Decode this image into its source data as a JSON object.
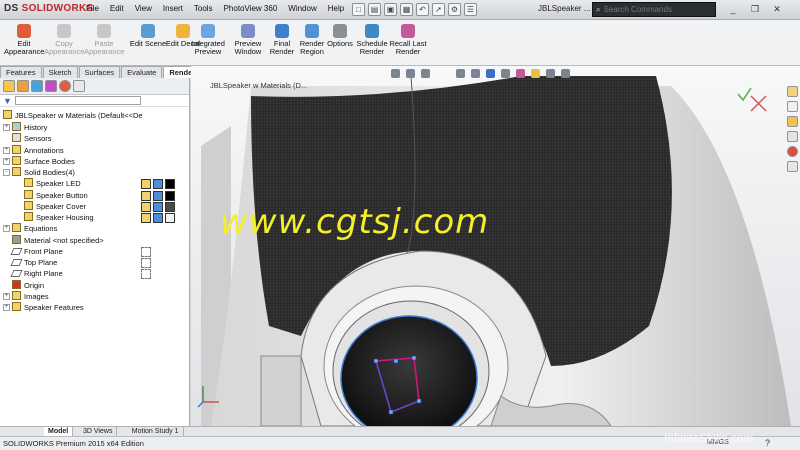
{
  "app": {
    "brand_prefix": "DS",
    "brand_name": "SOLIDWORKS"
  },
  "menu": [
    "File",
    "Edit",
    "View",
    "Insert",
    "Tools",
    "PhotoView 360",
    "Window",
    "Help"
  ],
  "doc_title": "JBLSpeaker ...",
  "search": {
    "placeholder": "Search Commands"
  },
  "ribbon": [
    {
      "label": "Edit Appearance",
      "icon": "appearance-icon",
      "enabled": true
    },
    {
      "label": "Copy Appearance",
      "icon": "copy-appearance-icon",
      "enabled": false
    },
    {
      "label": "Paste Appearance",
      "icon": "paste-appearance-icon",
      "enabled": false
    },
    {
      "label": "Edit Scene",
      "icon": "scene-icon",
      "enabled": true
    },
    {
      "label": "Edit Decal",
      "icon": "decal-icon",
      "enabled": true
    },
    {
      "label": "Integrated Preview",
      "icon": "integrated-preview-icon",
      "enabled": true
    },
    {
      "label": "Preview Window",
      "icon": "preview-window-icon",
      "enabled": true
    },
    {
      "label": "Final Render",
      "icon": "final-render-icon",
      "enabled": true
    },
    {
      "label": "Render Region",
      "icon": "render-region-icon",
      "enabled": true
    },
    {
      "label": "Options",
      "icon": "options-icon",
      "enabled": true
    },
    {
      "label": "Schedule Render",
      "icon": "schedule-render-icon",
      "enabled": true
    },
    {
      "label": "Recall Last Render",
      "icon": "recall-render-icon",
      "enabled": true
    }
  ],
  "command_tabs": [
    {
      "label": "Features",
      "active": false
    },
    {
      "label": "Sketch",
      "active": false
    },
    {
      "label": "Surfaces",
      "active": false
    },
    {
      "label": "Evaluate",
      "active": false
    },
    {
      "label": "Render Tools",
      "active": true
    }
  ],
  "tree": {
    "root": "JBLSpeaker w Materials  (Default<<De",
    "items": [
      {
        "label": "History",
        "icon": "history-icon",
        "expander": "+"
      },
      {
        "label": "Sensors",
        "icon": "sensor-icon",
        "expander": ""
      },
      {
        "label": "Annotations",
        "icon": "annotation-icon",
        "expander": "+"
      },
      {
        "label": "Surface Bodies",
        "icon": "folder-icon",
        "expander": "+"
      },
      {
        "label": "Solid Bodies(4)",
        "icon": "folder-icon",
        "expander": "-"
      },
      {
        "label": "Speaker LED",
        "icon": "body-icon",
        "expander": "",
        "indent": 2,
        "swatch": "#000000"
      },
      {
        "label": "Speaker Button",
        "icon": "body-icon",
        "expander": "",
        "indent": 2,
        "swatch": "#000000"
      },
      {
        "label": "Speaker Cover",
        "icon": "body-icon",
        "expander": "",
        "indent": 2,
        "swatch": "#4a4a4a"
      },
      {
        "label": "Speaker Housing",
        "icon": "body-icon",
        "expander": "",
        "indent": 2,
        "swatch": "#f2f2f2"
      },
      {
        "label": "Equations",
        "icon": "equation-icon",
        "expander": "+"
      },
      {
        "label": "Material <not specified>",
        "icon": "material-icon",
        "expander": ""
      },
      {
        "label": "Front Plane",
        "icon": "plane-icon",
        "expander": ""
      },
      {
        "label": "Top Plane",
        "icon": "plane-icon",
        "expander": ""
      },
      {
        "label": "Right Plane",
        "icon": "plane-icon",
        "expander": ""
      },
      {
        "label": "Origin",
        "icon": "origin-icon",
        "expander": ""
      },
      {
        "label": "Images",
        "icon": "folder-icon",
        "expander": "+"
      },
      {
        "label": "Speaker Features",
        "icon": "folder-icon",
        "expander": "+"
      }
    ]
  },
  "viewport": {
    "doc_title": "JBLSpeaker w Materials (D..."
  },
  "watermark": "www.cgtsj.com",
  "bottom_tabs": [
    {
      "label": "Model",
      "active": true
    },
    {
      "label": "3D Views",
      "active": false
    },
    {
      "label": "Motion Study 1",
      "active": false
    }
  ],
  "status": {
    "text": "SOLIDWORKS Premium 2015 x64 Edition",
    "units": "MMGS",
    "help": "?"
  },
  "brand_watermark": "InfiniteSkills.com",
  "colors": {
    "accent": "#c0272d",
    "watermark": "#f3ef2b",
    "viewport_bg": "#eef0f2"
  }
}
